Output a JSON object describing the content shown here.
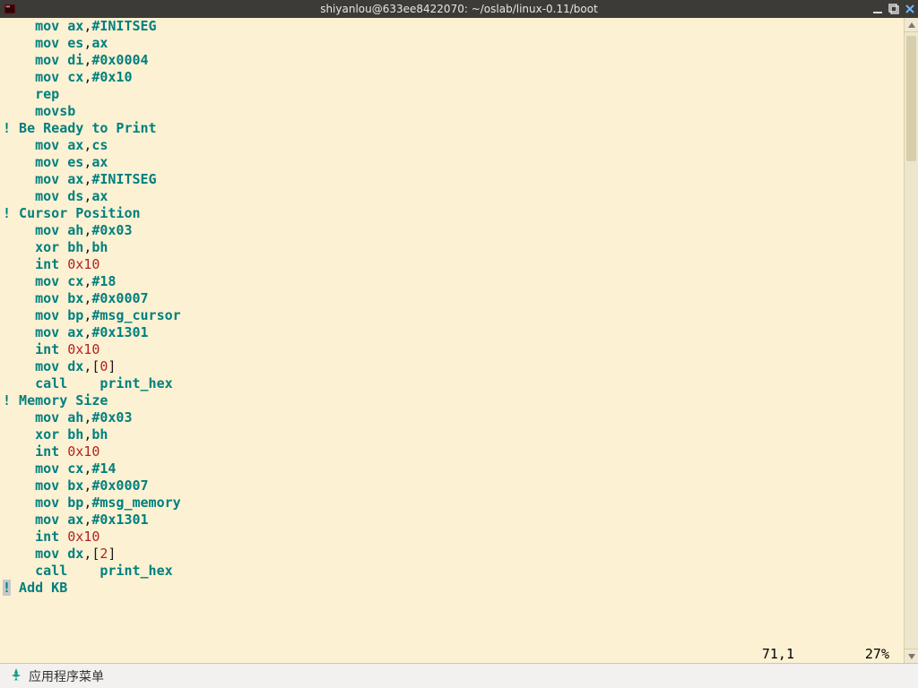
{
  "window": {
    "title": "shiyanlou@633ee8422070: ~/oslab/linux-0.11/boot"
  },
  "editor": {
    "lines": [
      [
        [
          "    ",
          "p"
        ],
        [
          "mov",
          "t"
        ],
        [
          " ",
          "p"
        ],
        [
          "ax",
          "t"
        ],
        [
          ",",
          "p"
        ],
        [
          "#INITSEG",
          "t"
        ]
      ],
      [
        [
          "    ",
          "p"
        ],
        [
          "mov",
          "t"
        ],
        [
          " ",
          "p"
        ],
        [
          "es",
          "t"
        ],
        [
          ",",
          "p"
        ],
        [
          "ax",
          "t"
        ]
      ],
      [
        [
          "    ",
          "p"
        ],
        [
          "mov",
          "t"
        ],
        [
          " ",
          "p"
        ],
        [
          "di",
          "t"
        ],
        [
          ",",
          "p"
        ],
        [
          "#0x0004",
          "t"
        ]
      ],
      [
        [
          "    ",
          "p"
        ],
        [
          "mov",
          "t"
        ],
        [
          " ",
          "p"
        ],
        [
          "cx",
          "t"
        ],
        [
          ",",
          "p"
        ],
        [
          "#0x10",
          "t"
        ]
      ],
      [
        [
          "    ",
          "p"
        ],
        [
          "rep",
          "t"
        ]
      ],
      [
        [
          "    ",
          "p"
        ],
        [
          "movsb",
          "t"
        ]
      ],
      [
        [
          "",
          "p"
        ]
      ],
      [
        [
          "! Be Ready to Print",
          "t"
        ]
      ],
      [
        [
          "    ",
          "p"
        ],
        [
          "mov",
          "t"
        ],
        [
          " ",
          "p"
        ],
        [
          "ax",
          "t"
        ],
        [
          ",",
          "p"
        ],
        [
          "cs",
          "t"
        ]
      ],
      [
        [
          "    ",
          "p"
        ],
        [
          "mov",
          "t"
        ],
        [
          " ",
          "p"
        ],
        [
          "es",
          "t"
        ],
        [
          ",",
          "p"
        ],
        [
          "ax",
          "t"
        ]
      ],
      [
        [
          "    ",
          "p"
        ],
        [
          "mov",
          "t"
        ],
        [
          " ",
          "p"
        ],
        [
          "ax",
          "t"
        ],
        [
          ",",
          "p"
        ],
        [
          "#INITSEG",
          "t"
        ]
      ],
      [
        [
          "    ",
          "p"
        ],
        [
          "mov",
          "t"
        ],
        [
          " ",
          "p"
        ],
        [
          "ds",
          "t"
        ],
        [
          ",",
          "p"
        ],
        [
          "ax",
          "t"
        ]
      ],
      [
        [
          "",
          "p"
        ]
      ],
      [
        [
          "! Cursor Position",
          "t"
        ]
      ],
      [
        [
          "    ",
          "p"
        ],
        [
          "mov",
          "t"
        ],
        [
          " ",
          "p"
        ],
        [
          "ah",
          "t"
        ],
        [
          ",",
          "p"
        ],
        [
          "#0x03",
          "t"
        ]
      ],
      [
        [
          "    ",
          "p"
        ],
        [
          "xor",
          "t"
        ],
        [
          " ",
          "p"
        ],
        [
          "bh",
          "t"
        ],
        [
          ",",
          "p"
        ],
        [
          "bh",
          "t"
        ]
      ],
      [
        [
          "    ",
          "p"
        ],
        [
          "int",
          "t"
        ],
        [
          " ",
          "p"
        ],
        [
          "0x10",
          "r"
        ]
      ],
      [
        [
          "    ",
          "p"
        ],
        [
          "mov",
          "t"
        ],
        [
          " ",
          "p"
        ],
        [
          "cx",
          "t"
        ],
        [
          ",",
          "p"
        ],
        [
          "#18",
          "t"
        ]
      ],
      [
        [
          "    ",
          "p"
        ],
        [
          "mov",
          "t"
        ],
        [
          " ",
          "p"
        ],
        [
          "bx",
          "t"
        ],
        [
          ",",
          "p"
        ],
        [
          "#0x0007",
          "t"
        ]
      ],
      [
        [
          "    ",
          "p"
        ],
        [
          "mov",
          "t"
        ],
        [
          " ",
          "p"
        ],
        [
          "bp",
          "t"
        ],
        [
          ",",
          "p"
        ],
        [
          "#msg_cursor",
          "t"
        ]
      ],
      [
        [
          "    ",
          "p"
        ],
        [
          "mov",
          "t"
        ],
        [
          " ",
          "p"
        ],
        [
          "ax",
          "t"
        ],
        [
          ",",
          "p"
        ],
        [
          "#0x1301",
          "t"
        ]
      ],
      [
        [
          "    ",
          "p"
        ],
        [
          "int",
          "t"
        ],
        [
          " ",
          "p"
        ],
        [
          "0x10",
          "r"
        ]
      ],
      [
        [
          "    ",
          "p"
        ],
        [
          "mov",
          "t"
        ],
        [
          " ",
          "p"
        ],
        [
          "dx",
          "t"
        ],
        [
          ",[",
          "p"
        ],
        [
          "0",
          "r"
        ],
        [
          "]",
          "p"
        ]
      ],
      [
        [
          "    ",
          "p"
        ],
        [
          "call",
          "t"
        ],
        [
          "    ",
          "p"
        ],
        [
          "print_hex",
          "t"
        ]
      ],
      [
        [
          "! Memory Size",
          "t"
        ]
      ],
      [
        [
          "    ",
          "p"
        ],
        [
          "mov",
          "t"
        ],
        [
          " ",
          "p"
        ],
        [
          "ah",
          "t"
        ],
        [
          ",",
          "p"
        ],
        [
          "#0x03",
          "t"
        ]
      ],
      [
        [
          "    ",
          "p"
        ],
        [
          "xor",
          "t"
        ],
        [
          " ",
          "p"
        ],
        [
          "bh",
          "t"
        ],
        [
          ",",
          "p"
        ],
        [
          "bh",
          "t"
        ]
      ],
      [
        [
          "    ",
          "p"
        ],
        [
          "int",
          "t"
        ],
        [
          " ",
          "p"
        ],
        [
          "0x10",
          "r"
        ]
      ],
      [
        [
          "    ",
          "p"
        ],
        [
          "mov",
          "t"
        ],
        [
          " ",
          "p"
        ],
        [
          "cx",
          "t"
        ],
        [
          ",",
          "p"
        ],
        [
          "#14",
          "t"
        ]
      ],
      [
        [
          "    ",
          "p"
        ],
        [
          "mov",
          "t"
        ],
        [
          " ",
          "p"
        ],
        [
          "bx",
          "t"
        ],
        [
          ",",
          "p"
        ],
        [
          "#0x0007",
          "t"
        ]
      ],
      [
        [
          "    ",
          "p"
        ],
        [
          "mov",
          "t"
        ],
        [
          " ",
          "p"
        ],
        [
          "bp",
          "t"
        ],
        [
          ",",
          "p"
        ],
        [
          "#msg_memory",
          "t"
        ]
      ],
      [
        [
          "    ",
          "p"
        ],
        [
          "mov",
          "t"
        ],
        [
          " ",
          "p"
        ],
        [
          "ax",
          "t"
        ],
        [
          ",",
          "p"
        ],
        [
          "#0x1301",
          "t"
        ]
      ],
      [
        [
          "    ",
          "p"
        ],
        [
          "int",
          "t"
        ],
        [
          " ",
          "p"
        ],
        [
          "0x10",
          "r"
        ]
      ],
      [
        [
          "    ",
          "p"
        ],
        [
          "mov",
          "t"
        ],
        [
          " ",
          "p"
        ],
        [
          "dx",
          "t"
        ],
        [
          ",[",
          "p"
        ],
        [
          "2",
          "r"
        ],
        [
          "]",
          "p"
        ]
      ],
      [
        [
          "    ",
          "p"
        ],
        [
          "call",
          "t"
        ],
        [
          "    ",
          "p"
        ],
        [
          "print_hex",
          "t"
        ]
      ],
      [
        [
          "!",
          "hl"
        ],
        [
          " Add KB",
          "t"
        ]
      ]
    ],
    "cursor_pos": "71,1",
    "scroll_pct": "27%"
  },
  "taskbar": {
    "menu_label": "应用程序菜单"
  }
}
